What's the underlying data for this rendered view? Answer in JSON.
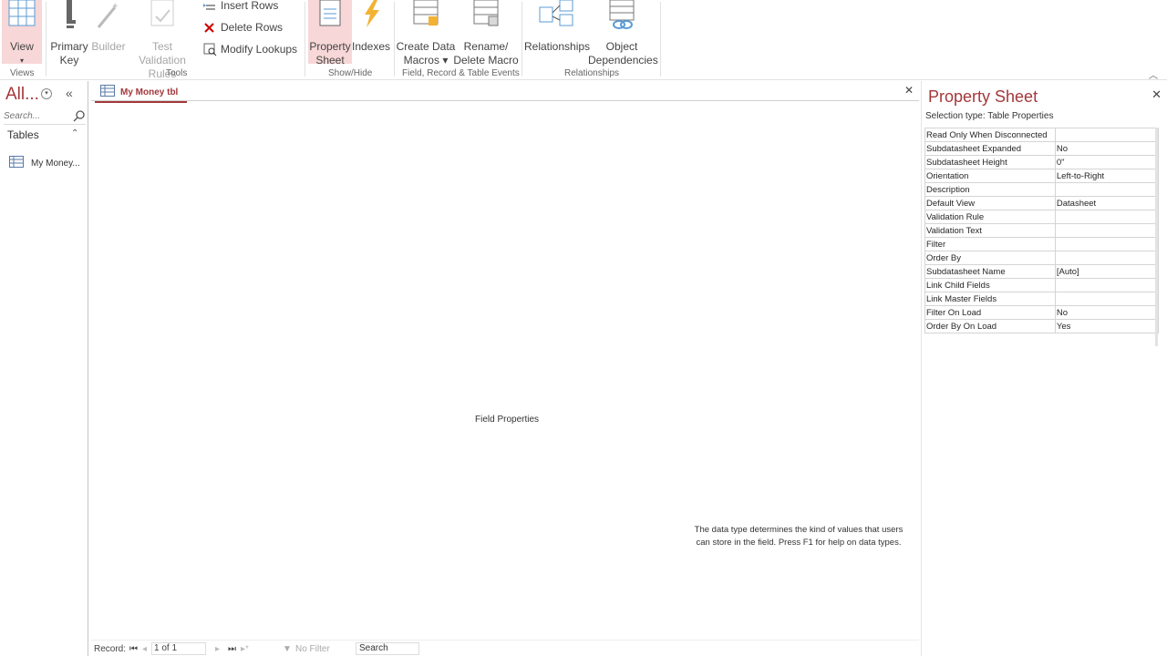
{
  "ribbon": {
    "views": {
      "view_label": "View",
      "group": "Views"
    },
    "tools": {
      "primary_key": [
        "Primary",
        "Key"
      ],
      "builder": "Builder",
      "test_validation": [
        "Test Validation",
        "Rules"
      ],
      "insert_rows": "Insert Rows",
      "delete_rows": "Delete Rows",
      "modify_lookups": "Modify Lookups",
      "group": "Tools"
    },
    "showhide": {
      "property_sheet": [
        "Property",
        "Sheet"
      ],
      "indexes": "Indexes",
      "group": "Show/Hide"
    },
    "events": {
      "create_data_macros": [
        "Create Data",
        "Macros ▾"
      ],
      "rename_delete_macro": [
        "Rename/",
        "Delete Macro"
      ],
      "group": "Field, Record & Table Events"
    },
    "relationships": {
      "relationships": "Relationships",
      "object_dependencies": [
        "Object",
        "Dependencies"
      ],
      "group": "Relationships"
    }
  },
  "nav": {
    "title": "All...",
    "search_placeholder": "Search...",
    "group_label": "Tables",
    "items": [
      {
        "label": "My Money..."
      }
    ]
  },
  "document": {
    "tab_label": "My Money tbl",
    "field_properties_label": "Field Properties",
    "help_text": "The data type determines the kind of values that users can store in the field. Press F1 for help on data types."
  },
  "status": {
    "record_label": "Record:",
    "record_value": "1 of 1",
    "filter_label": "No Filter",
    "search_label": "Search"
  },
  "property_sheet": {
    "title": "Property Sheet",
    "selection_type": "Selection type:  Table Properties",
    "rows": [
      {
        "key": "Read Only When Disconnected",
        "value": ""
      },
      {
        "key": "Subdatasheet Expanded",
        "value": "No"
      },
      {
        "key": "Subdatasheet Height",
        "value": "0\""
      },
      {
        "key": "Orientation",
        "value": "Left-to-Right"
      },
      {
        "key": "Description",
        "value": ""
      },
      {
        "key": "Default View",
        "value": "Datasheet"
      },
      {
        "key": "Validation Rule",
        "value": ""
      },
      {
        "key": "Validation Text",
        "value": ""
      },
      {
        "key": "Filter",
        "value": ""
      },
      {
        "key": "Order By",
        "value": ""
      },
      {
        "key": "Subdatasheet Name",
        "value": "[Auto]"
      },
      {
        "key": "Link Child Fields",
        "value": ""
      },
      {
        "key": "Link Master Fields",
        "value": ""
      },
      {
        "key": "Filter On Load",
        "value": "No"
      },
      {
        "key": "Order By On Load",
        "value": "Yes"
      }
    ]
  },
  "colors": {
    "accent": "#a4373a",
    "active_button_bg": "#f7d7d7"
  }
}
